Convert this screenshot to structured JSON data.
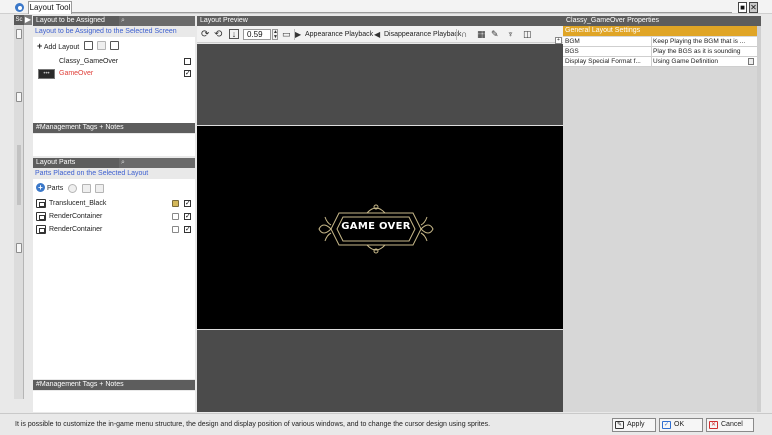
{
  "window": {
    "title": "Layout Tool",
    "minimize": "■",
    "close": "✕"
  },
  "sidebar": {
    "tab_label": "Sc",
    "collapse": "▶"
  },
  "layout_assign": {
    "header": "Layout to be Assigned",
    "subtitle": "Layout to be Assigned to the Selected Screen",
    "add_label": "Add Layout",
    "rows": [
      {
        "name": "Classy_GameOver",
        "checked": false,
        "highlight": false
      },
      {
        "name": "GameOver",
        "checked": true,
        "highlight": true,
        "thumb": "•••"
      }
    ],
    "tags_header": "#Management Tags + Notes"
  },
  "layout_parts": {
    "header": "Layout Parts",
    "subtitle": "Parts Placed on the Selected Layout",
    "parts_label": "Parts",
    "rows": [
      {
        "name": "Translucent_Black",
        "locked": true,
        "checked": true
      },
      {
        "name": "RenderContainer",
        "locked": false,
        "checked": true
      },
      {
        "name": "RenderContainer",
        "locked": false,
        "checked": true
      }
    ],
    "tags_header": "#Management Tags + Notes"
  },
  "preview": {
    "header": "Layout Preview",
    "zoom": "0.59",
    "appearance_label": "Appearance Playback",
    "disappearance_label": "Disappearance Playback",
    "game_over_text": "GAME OVER",
    "colors": {
      "dark": "#4b4b4b",
      "frame": "#c8b98a"
    }
  },
  "properties": {
    "header": "Classy_GameOver Properties",
    "section": "General Layout Settings",
    "rows": [
      {
        "name": "BGM",
        "value": "Keep Playing the BGM that is ..."
      },
      {
        "name": "BGS",
        "value": "Play the BGS as it is sounding"
      },
      {
        "name": "Display Special Format f...",
        "value": "Using Game Definition"
      }
    ],
    "colors": {
      "section": "#e0a526"
    }
  },
  "status": {
    "message": "It is possible to customize the in-game menu structure, the design and display position of various windows, and to change the cursor design using sprites.",
    "apply": "Apply",
    "ok": "OK",
    "cancel": "Cancel"
  }
}
